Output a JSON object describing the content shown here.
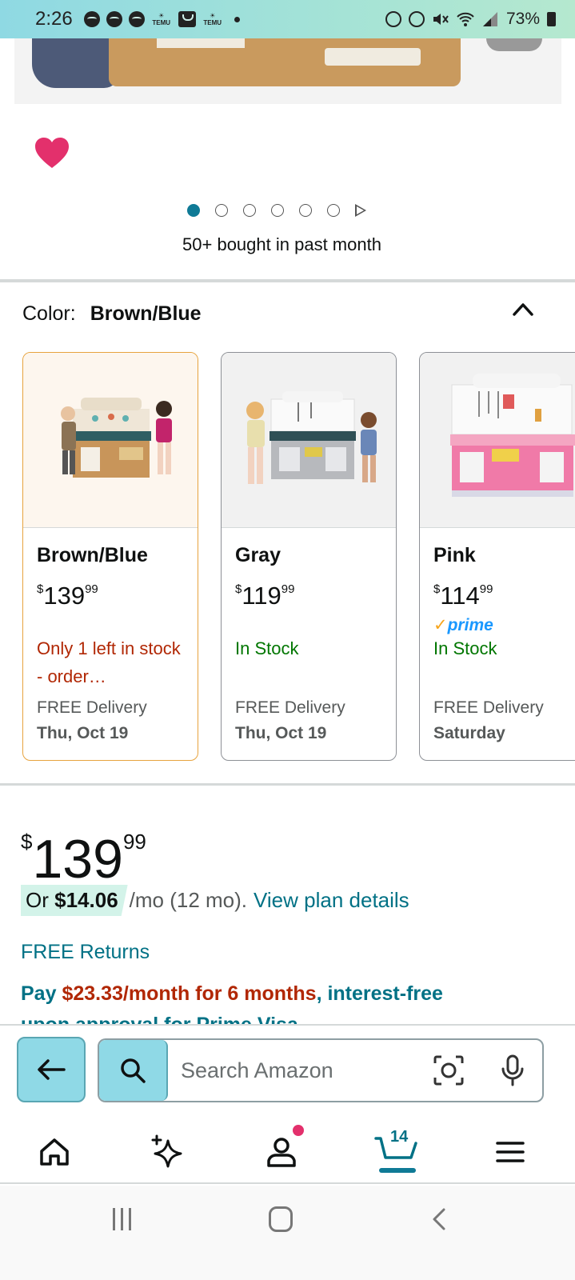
{
  "status_bar": {
    "time": "2:26",
    "temu_label": "TEMU",
    "battery": "73%"
  },
  "product": {
    "bought_text": "50+ bought in past month",
    "carousel": {
      "count": 6,
      "active_index": 0
    }
  },
  "color_selector": {
    "label": "Color:",
    "value": "Brown/Blue"
  },
  "variants": [
    {
      "name": "Brown/Blue",
      "price_dollar": "$",
      "price_whole": "139",
      "price_cents": "99",
      "prime": "",
      "stock": "Only 1 left in stock - order…",
      "delivery": "FREE Delivery",
      "date": "Thu, Oct 19",
      "selected": true
    },
    {
      "name": "Gray",
      "price_dollar": "$",
      "price_whole": "119",
      "price_cents": "99",
      "prime": "",
      "stock": "In Stock",
      "delivery": "FREE Delivery",
      "date": "Thu, Oct 19",
      "selected": false
    },
    {
      "name": "Pink",
      "price_dollar": "$",
      "price_whole": "114",
      "price_cents": "99",
      "prime": "prime",
      "stock": "In Stock",
      "delivery": "FREE Delivery",
      "date": "Saturday",
      "selected": false
    }
  ],
  "price": {
    "dollar": "$",
    "whole": "139",
    "cents": "99",
    "monthly_prefix": "Or",
    "monthly_amount": "$14.06",
    "monthly_term": "/mo (12 mo).",
    "plan_link": "View plan details",
    "free_returns": "FREE Returns",
    "pay_prefix": "Pay",
    "pay_amount": "$23.33/month for 6 months",
    "pay_suffix": ", interest-free",
    "pay_line2": "upon approval for Prime Visa"
  },
  "search": {
    "placeholder": "Search Amazon"
  },
  "nav": {
    "cart_count": "14"
  },
  "colors": {
    "accent_teal": "#8fd9e6",
    "link": "#007185",
    "price_red": "#b12704",
    "stock_green": "#007600",
    "heart": "#e3306c"
  }
}
